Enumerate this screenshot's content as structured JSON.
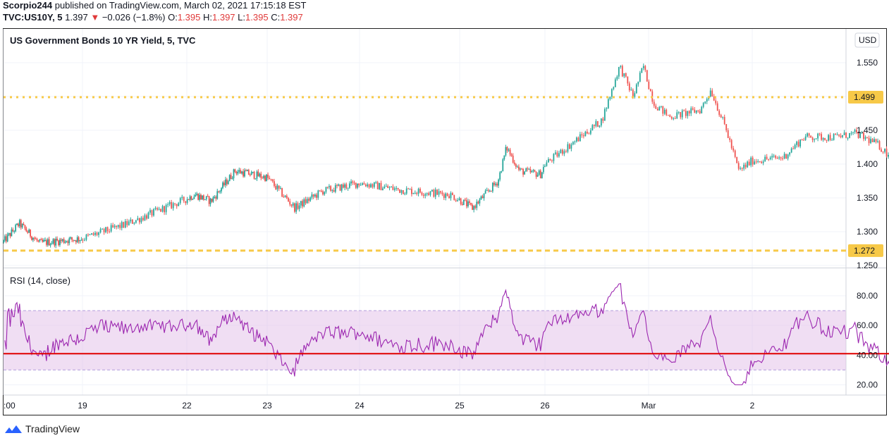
{
  "header": {
    "publisher": "Scorpio244",
    "published_text": "published on TradingView.com, March 02, 2021 17:15:18 EST",
    "symbol": "TVC:US10Y, 5",
    "last": "1.397",
    "change_arrow": "▼",
    "change": "−0.026 (−1.8%)",
    "o_label": "O:",
    "o_value": "1.395",
    "h_label": "H:",
    "h_value": "1.397",
    "l_label": "L:",
    "l_value": "1.395",
    "c_label": "C:",
    "c_value": "1.397"
  },
  "footer": {
    "brand": "TradingView"
  },
  "colors": {
    "up": "#26a69a",
    "down": "#ef5350",
    "candle_body": "#333333",
    "level_line": "#f7c948",
    "rsi_line": "#9c27b0",
    "rsi_band": "#e1bee7",
    "trend_line": "#e00000"
  },
  "chart_data": [
    {
      "type": "candlestick",
      "title": "US Government Bonds 10 YR Yield, 5, TVC",
      "currency": "USD",
      "x_ticks": [
        ":00",
        "19",
        "22",
        "23",
        "24",
        "25",
        "26",
        "Mar",
        "2"
      ],
      "y_ticks": [
        "1.250",
        "1.300",
        "1.350",
        "1.400",
        "1.450",
        "1.500",
        "1.550"
      ],
      "ylim": [
        1.25,
        1.565
      ],
      "horizontal_levels": [
        {
          "value": 1.499,
          "label": "1.499",
          "style": "dotted"
        },
        {
          "value": 1.272,
          "label": "1.272",
          "style": "dashed"
        }
      ],
      "price_path": [
        {
          "x": 0.0,
          "y": 1.285
        },
        {
          "x": 0.2,
          "y": 1.312
        },
        {
          "x": 0.45,
          "y": 1.283
        },
        {
          "x": 1.0,
          "y": 1.29
        },
        {
          "x": 1.4,
          "y": 1.31
        },
        {
          "x": 2.1,
          "y": 1.355
        },
        {
          "x": 2.3,
          "y": 1.345
        },
        {
          "x": 2.6,
          "y": 1.39
        },
        {
          "x": 3.0,
          "y": 1.38
        },
        {
          "x": 3.3,
          "y": 1.335
        },
        {
          "x": 3.6,
          "y": 1.36
        },
        {
          "x": 4.0,
          "y": 1.372
        },
        {
          "x": 4.4,
          "y": 1.362
        },
        {
          "x": 4.9,
          "y": 1.355
        },
        {
          "x": 5.15,
          "y": 1.335
        },
        {
          "x": 5.45,
          "y": 1.375
        },
        {
          "x": 5.55,
          "y": 1.425
        },
        {
          "x": 5.7,
          "y": 1.39
        },
        {
          "x": 5.95,
          "y": 1.385
        },
        {
          "x": 6.0,
          "y": 1.4
        },
        {
          "x": 6.3,
          "y": 1.435
        },
        {
          "x": 6.55,
          "y": 1.465
        },
        {
          "x": 6.72,
          "y": 1.545
        },
        {
          "x": 6.85,
          "y": 1.5
        },
        {
          "x": 6.95,
          "y": 1.545
        },
        {
          "x": 7.05,
          "y": 1.49
        },
        {
          "x": 7.2,
          "y": 1.47
        },
        {
          "x": 7.5,
          "y": 1.48
        },
        {
          "x": 7.6,
          "y": 1.51
        },
        {
          "x": 7.75,
          "y": 1.45
        },
        {
          "x": 7.87,
          "y": 1.39
        },
        {
          "x": 8.0,
          "y": 1.405
        },
        {
          "x": 8.3,
          "y": 1.41
        },
        {
          "x": 8.5,
          "y": 1.44
        },
        {
          "x": 8.8,
          "y": 1.44
        },
        {
          "x": 9.0,
          "y": 1.445
        },
        {
          "x": 9.2,
          "y": 1.43
        },
        {
          "x": 9.4,
          "y": 1.402
        },
        {
          "x": 9.6,
          "y": 1.415
        },
        {
          "x": 9.75,
          "y": 1.445
        },
        {
          "x": 9.9,
          "y": 1.425
        },
        {
          "x": 10.1,
          "y": 1.41
        },
        {
          "x": 10.18,
          "y": 1.395
        }
      ]
    },
    {
      "type": "line",
      "title": "RSI (14, close)",
      "y_ticks": [
        "20.00",
        "40.00",
        "60.00",
        "80.00"
      ],
      "ylim": [
        15,
        93
      ],
      "band": [
        30,
        70
      ],
      "trend_line": {
        "x0": 0.0,
        "y0": 41,
        "x1": 10.22,
        "y1": 41
      },
      "series": [
        {
          "values_range": [
            20,
            90
          ]
        }
      ]
    }
  ]
}
